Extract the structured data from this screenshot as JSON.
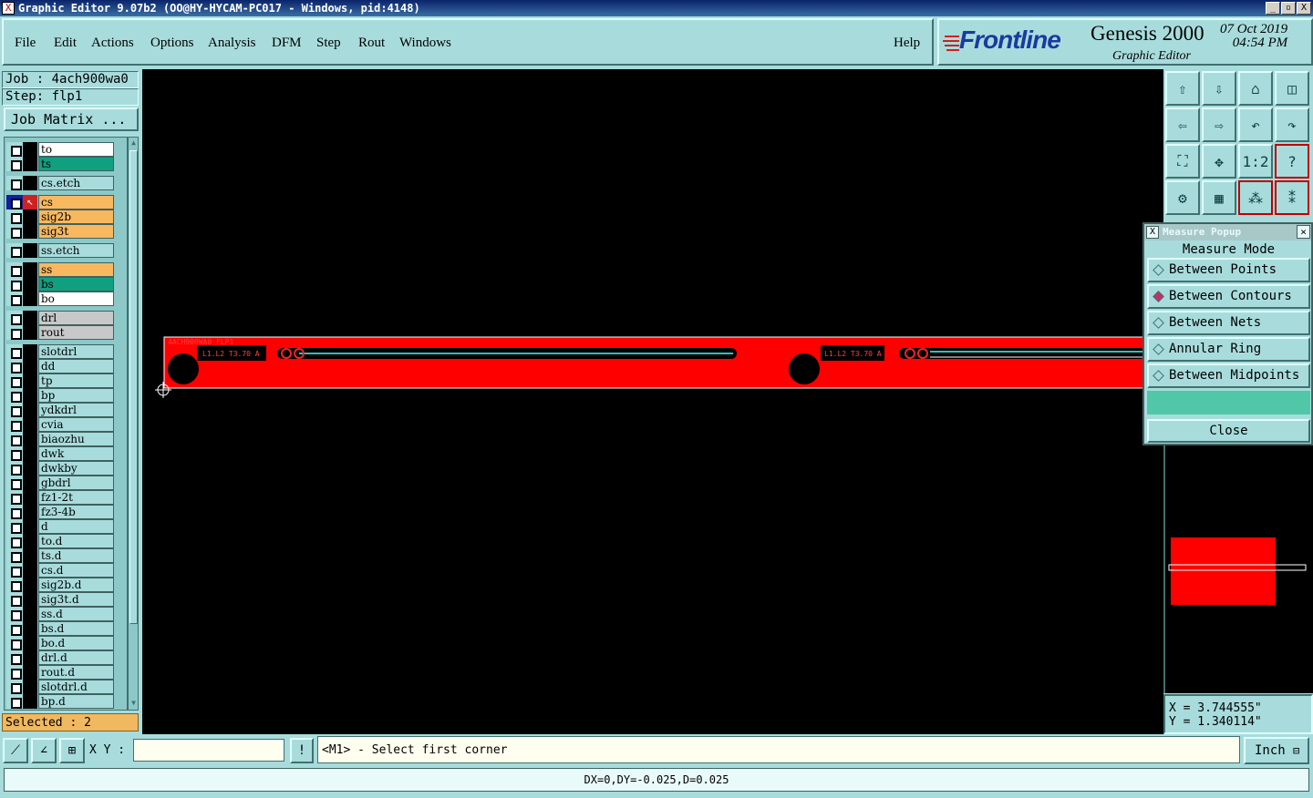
{
  "window": {
    "title": "Graphic Editor 9.07b2 (OO@HY-HYCAM-PC017 - Windows, pid:4148)",
    "buttons": [
      "_",
      "▫",
      "X"
    ]
  },
  "menu": {
    "items": [
      "File",
      "Edit",
      "Actions",
      "Options",
      "Analysis",
      "DFM",
      "Step",
      "Rout",
      "Windows"
    ],
    "help": "Help"
  },
  "brand": {
    "logo": "Frontline",
    "name": "Genesis 2000",
    "subtitle": "Graphic Editor",
    "date": "07 Oct 2019",
    "time": "04:54 PM"
  },
  "job": {
    "job_label": "Job : 4ach900wa0",
    "step_label": "Step: flp1",
    "matrix_button": "Job Matrix ..."
  },
  "layers": [
    {
      "name": "to",
      "color": "#ffffff"
    },
    {
      "name": "ts",
      "color": "#10a080"
    },
    {
      "name": "cs.etch",
      "color": "#a8dcdc"
    },
    {
      "name": "cs",
      "color": "#f8b860",
      "active": true
    },
    {
      "name": "sig2b",
      "color": "#f8b860"
    },
    {
      "name": "sig3t",
      "color": "#f8b860"
    },
    {
      "name": "ss.etch",
      "color": "#a8dcdc"
    },
    {
      "name": "ss",
      "color": "#f8b860"
    },
    {
      "name": "bs",
      "color": "#10a080"
    },
    {
      "name": "bo",
      "color": "#ffffff"
    },
    {
      "name": "drl",
      "color": "#c8c8c8"
    },
    {
      "name": "rout",
      "color": "#c8c8c8"
    },
    {
      "name": "slotdrl",
      "color": "#a8dcdc"
    },
    {
      "name": "dd",
      "color": "#a8dcdc"
    },
    {
      "name": "tp",
      "color": "#a8dcdc"
    },
    {
      "name": "bp",
      "color": "#a8dcdc"
    },
    {
      "name": "ydkdrl",
      "color": "#a8dcdc"
    },
    {
      "name": "cvia",
      "color": "#a8dcdc"
    },
    {
      "name": "biaozhu",
      "color": "#a8dcdc"
    },
    {
      "name": "dwk",
      "color": "#a8dcdc"
    },
    {
      "name": "dwkby",
      "color": "#a8dcdc"
    },
    {
      "name": "gbdrl",
      "color": "#a8dcdc"
    },
    {
      "name": "fz1-2t",
      "color": "#a8dcdc"
    },
    {
      "name": "fz3-4b",
      "color": "#a8dcdc"
    },
    {
      "name": "d",
      "color": "#a8dcdc"
    },
    {
      "name": "to.d",
      "color": "#a8dcdc"
    },
    {
      "name": "ts.d",
      "color": "#a8dcdc"
    },
    {
      "name": "cs.d",
      "color": "#a8dcdc"
    },
    {
      "name": "sig2b.d",
      "color": "#a8dcdc"
    },
    {
      "name": "sig3t.d",
      "color": "#a8dcdc"
    },
    {
      "name": "ss.d",
      "color": "#a8dcdc"
    },
    {
      "name": "bs.d",
      "color": "#a8dcdc"
    },
    {
      "name": "bo.d",
      "color": "#a8dcdc"
    },
    {
      "name": "drl.d",
      "color": "#a8dcdc"
    },
    {
      "name": "rout.d",
      "color": "#a8dcdc"
    },
    {
      "name": "slotdrl.d",
      "color": "#a8dcdc"
    },
    {
      "name": "bp.d",
      "color": "#a8dcdc"
    }
  ],
  "selected_label": "Selected : 2",
  "canvas": {
    "board_label": "4ACH900WA0 FLP1",
    "tag1": "L1.L2 T3.70 A",
    "tag2": "L1.L2 T3.70 A"
  },
  "toolbar_icons": [
    "zoom-home-icon",
    "zoom-in-icon",
    "home-icon",
    "split-view-icon",
    "pan-left-icon",
    "pan-right-icon",
    "undo-icon",
    "redo-icon",
    "fit-screen-icon",
    "fit-profile-icon",
    "one-to-two-icon",
    "help-icon",
    "settings-icon",
    "grid-icon",
    "netlist-icon",
    "connect-icon"
  ],
  "popup": {
    "title": "Measure Popup",
    "heading": "Measure Mode",
    "options": [
      "Between Points",
      "Between Contours",
      "Between Nets",
      "Annular Ring",
      "Between Midpoints"
    ],
    "selected_index": 1,
    "close_label": "Close"
  },
  "coords": {
    "x": "X = 3.744555\"",
    "y": "Y = 1.340114\""
  },
  "bottom": {
    "xy_label": "X Y :",
    "xy_value": "",
    "prompt": "<M1> - Select first corner",
    "unit": "Inch",
    "status": "DX=0,DY=-0.025,D=0.025"
  },
  "colors": {
    "panel": "#a8dcdc",
    "board": "#ff0000",
    "active_layer_icon": "#d02020",
    "radio_selected": "#c0306a"
  }
}
